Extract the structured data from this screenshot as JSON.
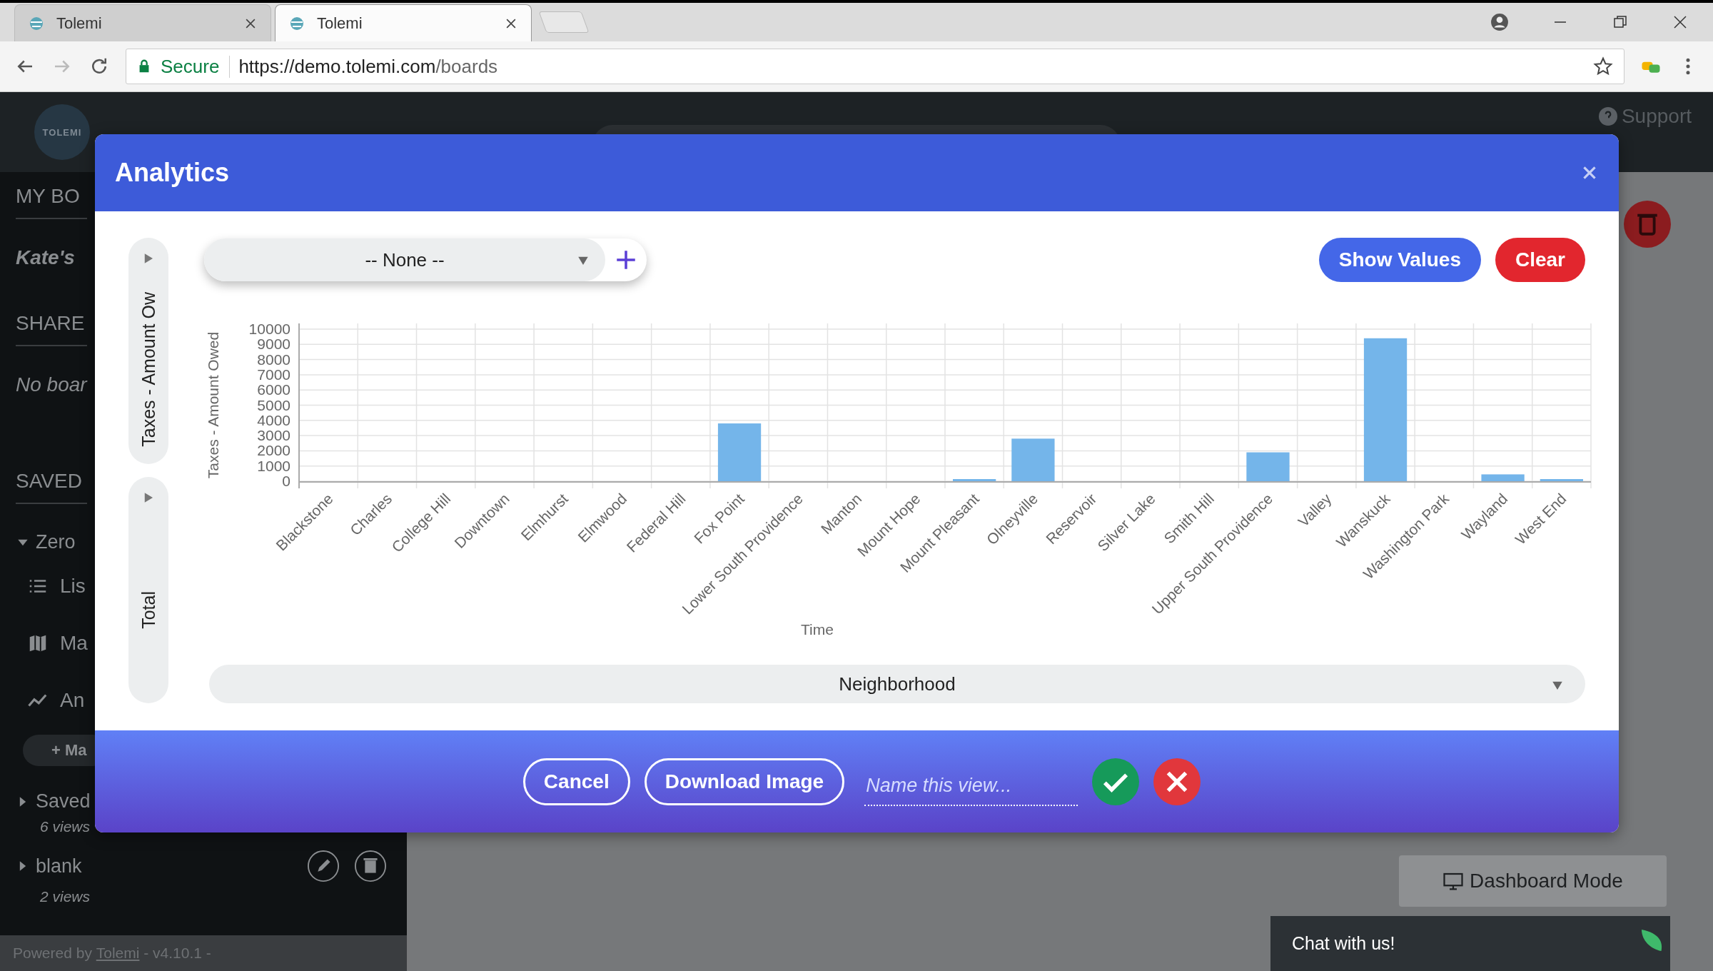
{
  "browser": {
    "tabs": [
      {
        "title": "Tolemi",
        "selected": false
      },
      {
        "title": "Tolemi",
        "selected": true
      }
    ],
    "address": {
      "secure_label": "Secure",
      "url_host": "https://demo.tolemi.com",
      "url_path": "/boards"
    }
  },
  "app_header": {
    "logo": "TOLEMI",
    "support": "Support"
  },
  "sidebar": {
    "items": [
      {
        "kind": "heading",
        "text": "MY BO"
      },
      {
        "kind": "board",
        "text": "Kate's"
      },
      {
        "kind": "heading",
        "text": "SHARE"
      },
      {
        "kind": "note",
        "text": "No boar"
      },
      {
        "kind": "heading",
        "text": "SAVED"
      },
      {
        "kind": "group",
        "text": "Zero",
        "expanded": true,
        "actions": false
      },
      {
        "kind": "list-view",
        "text": "Lis"
      },
      {
        "kind": "map-view",
        "text": "Ma"
      },
      {
        "kind": "chart-view",
        "text": "An"
      },
      {
        "kind": "add",
        "text": "+ Ma"
      },
      {
        "kind": "group",
        "text": "Saved",
        "expanded": false,
        "count": "6 views",
        "actions": false
      },
      {
        "kind": "group",
        "text": "blank",
        "expanded": false,
        "count": "2 views",
        "actions": true
      }
    ],
    "footer": {
      "prefix": "Powered by",
      "link": "Tolemi",
      "suffix": "- v4.10.1 -"
    }
  },
  "modal": {
    "title": "Analytics",
    "measures": [
      {
        "label": "Taxes - Amount Ow"
      },
      {
        "label": "Total"
      }
    ],
    "group_by": {
      "value": "-- None --"
    },
    "buttons": [
      {
        "label": "Show Values",
        "kind": "primary"
      },
      {
        "label": "Clear",
        "kind": "danger"
      }
    ],
    "chart_data": {
      "type": "bar",
      "xlabel": "Time",
      "ylabel": "Taxes - Amount Owed",
      "categories": [
        "Blackstone",
        "Charles",
        "College Hill",
        "Downtown",
        "Elmhurst",
        "Elmwood",
        "Federal Hill",
        "Fox Point",
        "Lower South Providence",
        "Manton",
        "Mount Hope",
        "Mount Pleasant",
        "Olneyville",
        "Reservoir",
        "Silver Lake",
        "Smith Hill",
        "Upper South Providence",
        "Valley",
        "Wanskuck",
        "Washington Park",
        "Wayland",
        "West End"
      ],
      "values": [
        0,
        0,
        0,
        0,
        0,
        0,
        0,
        3800,
        0,
        0,
        0,
        100,
        2800,
        0,
        0,
        0,
        1900,
        0,
        9400,
        0,
        450,
        100
      ],
      "ylim": [
        0,
        10000
      ],
      "grid": true,
      "yticks": [
        0,
        1000,
        2000,
        3000,
        4000,
        5000,
        6000,
        7000,
        8000,
        9000,
        10000
      ]
    },
    "x_dimension": {
      "value": "Neighborhood"
    },
    "footer": {
      "buttons": [
        {
          "label": "Cancel"
        },
        {
          "label": "Download Image"
        }
      ],
      "name_field": {
        "placeholder": "Name this view..."
      }
    }
  },
  "main": {
    "dashboard_button": "Dashboard Mode"
  },
  "chat": {
    "label": "Chat with us!"
  }
}
